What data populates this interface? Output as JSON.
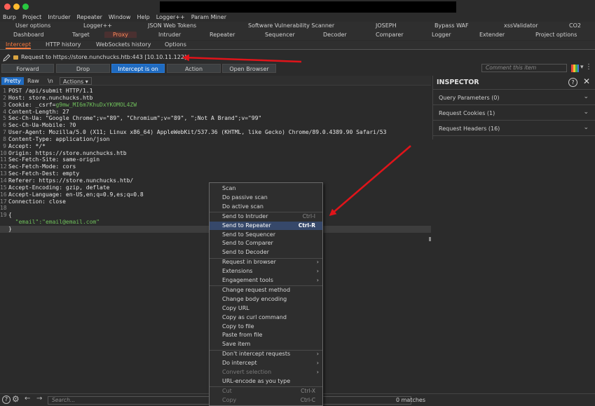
{
  "menubar": [
    "Burp",
    "Project",
    "Intruder",
    "Repeater",
    "Window",
    "Help",
    "Logger++",
    "Param Miner"
  ],
  "extension_tabs": [
    "User options",
    "Logger++",
    "JSON Web Tokens",
    "Software Vulnerability Scanner",
    "JOSEPH",
    "Bypass WAF",
    "xssValidator",
    "CO2"
  ],
  "main_tabs": [
    "Dashboard",
    "Target",
    "Proxy",
    "Intruder",
    "Repeater",
    "Sequencer",
    "Decoder",
    "Comparer",
    "Logger",
    "Extender",
    "Project options"
  ],
  "proxy_tabs": [
    "Intercept",
    "HTTP history",
    "WebSockets history",
    "Options"
  ],
  "request_info": "Request to https://store.nunchucks.htb:443  [10.10.11.122]",
  "buttons": {
    "forward": "Forward",
    "drop": "Drop",
    "intercept": "Intercept is on",
    "action": "Action",
    "open_browser": "Open Browser"
  },
  "comment_placeholder": "Comment this item",
  "editor_tabs": [
    "Pretty",
    "Raw",
    "\\n",
    "Actions ▾"
  ],
  "request_lines": [
    {
      "n": "1",
      "text": "POST /api/submit HTTP/1.1",
      "cls": ""
    },
    {
      "n": "2",
      "text": "Host: store.nunchucks.htb",
      "cls": ""
    },
    {
      "n": "3",
      "text": "Cookie: _csrf=g9mw_MI6m7KhuDxYKOMOL4ZW",
      "cls": "cookie"
    },
    {
      "n": "4",
      "text": "Content-Length: 27",
      "cls": ""
    },
    {
      "n": "5",
      "text": "Sec-Ch-Ua: \"Google Chrome\";v=\"89\", \"Chromium\";v=\"89\", \";Not A Brand\";v=\"99\"",
      "cls": ""
    },
    {
      "n": "6",
      "text": "Sec-Ch-Ua-Mobile: ?0",
      "cls": ""
    },
    {
      "n": "7",
      "text": "User-Agent: Mozilla/5.0 (X11; Linux x86_64) AppleWebKit/537.36 (KHTML, like Gecko) Chrome/89.0.4389.90 Safari/53",
      "cls": ""
    },
    {
      "n": "8",
      "text": "Content-Type: application/json",
      "cls": ""
    },
    {
      "n": "9",
      "text": "Accept: */*",
      "cls": ""
    },
    {
      "n": "10",
      "text": "Origin: https://store.nunchucks.htb",
      "cls": ""
    },
    {
      "n": "11",
      "text": "Sec-Fetch-Site: same-origin",
      "cls": ""
    },
    {
      "n": "12",
      "text": "Sec-Fetch-Mode: cors",
      "cls": ""
    },
    {
      "n": "13",
      "text": "Sec-Fetch-Dest: empty",
      "cls": ""
    },
    {
      "n": "14",
      "text": "Referer: https://store.nunchucks.htb/",
      "cls": ""
    },
    {
      "n": "15",
      "text": "Accept-Encoding: gzip, deflate",
      "cls": ""
    },
    {
      "n": "16",
      "text": "Accept-Language: en-US,en;q=0.9,es;q=0.8",
      "cls": ""
    },
    {
      "n": "17",
      "text": "Connection: close",
      "cls": ""
    },
    {
      "n": "18",
      "text": "",
      "cls": ""
    },
    {
      "n": "19",
      "text": "{",
      "cls": ""
    },
    {
      "n": "",
      "text": "  \"email\":\"email@email.com\"",
      "cls": "json"
    },
    {
      "n": "",
      "text": "}",
      "cls": "hl"
    }
  ],
  "inspector": {
    "title": "INSPECTOR",
    "rows": [
      "Query Parameters (0)",
      "Request Cookies (1)",
      "Request Headers (16)"
    ]
  },
  "search_placeholder": "Search...",
  "matches": "0 matches",
  "context_menu": [
    {
      "label": "Scan",
      "shortcut": "",
      "sub": false,
      "disabled": false,
      "sel": false
    },
    {
      "label": "Do passive scan",
      "shortcut": "",
      "sub": false,
      "disabled": false,
      "sel": false
    },
    {
      "label": "Do active scan",
      "shortcut": "",
      "sub": false,
      "disabled": false,
      "sel": false
    },
    {
      "label": "Send to Intruder",
      "shortcut": "Ctrl-I",
      "sub": false,
      "disabled": false,
      "sel": false
    },
    {
      "label": "Send to Repeater",
      "shortcut": "Ctrl-R",
      "sub": false,
      "disabled": false,
      "sel": true
    },
    {
      "label": "Send to Sequencer",
      "shortcut": "",
      "sub": false,
      "disabled": false,
      "sel": false
    },
    {
      "label": "Send to Comparer",
      "shortcut": "",
      "sub": false,
      "disabled": false,
      "sel": false
    },
    {
      "label": "Send to Decoder",
      "shortcut": "",
      "sub": false,
      "disabled": false,
      "sel": false
    },
    {
      "label": "Request in browser",
      "shortcut": "",
      "sub": true,
      "disabled": false,
      "sel": false
    },
    {
      "label": "Extensions",
      "shortcut": "",
      "sub": true,
      "disabled": false,
      "sel": false
    },
    {
      "label": "Engagement tools",
      "shortcut": "",
      "sub": true,
      "disabled": false,
      "sel": false
    },
    {
      "label": "Change request method",
      "shortcut": "",
      "sub": false,
      "disabled": false,
      "sel": false
    },
    {
      "label": "Change body encoding",
      "shortcut": "",
      "sub": false,
      "disabled": false,
      "sel": false
    },
    {
      "label": "Copy URL",
      "shortcut": "",
      "sub": false,
      "disabled": false,
      "sel": false
    },
    {
      "label": "Copy as curl command",
      "shortcut": "",
      "sub": false,
      "disabled": false,
      "sel": false
    },
    {
      "label": "Copy to file",
      "shortcut": "",
      "sub": false,
      "disabled": false,
      "sel": false
    },
    {
      "label": "Paste from file",
      "shortcut": "",
      "sub": false,
      "disabled": false,
      "sel": false
    },
    {
      "label": "Save item",
      "shortcut": "",
      "sub": false,
      "disabled": false,
      "sel": false
    },
    {
      "label": "Don't intercept requests",
      "shortcut": "",
      "sub": true,
      "disabled": false,
      "sel": false
    },
    {
      "label": "Do intercept",
      "shortcut": "",
      "sub": true,
      "disabled": false,
      "sel": false
    },
    {
      "label": "Convert selection",
      "shortcut": "",
      "sub": true,
      "disabled": true,
      "sel": false
    },
    {
      "label": "URL-encode as you type",
      "shortcut": "",
      "sub": false,
      "disabled": false,
      "sel": false
    },
    {
      "label": "Cut",
      "shortcut": "Ctrl-X",
      "sub": false,
      "disabled": true,
      "sel": false
    },
    {
      "label": "Copy",
      "shortcut": "Ctrl-C",
      "sub": false,
      "disabled": true,
      "sel": false
    },
    {
      "label": "Paste",
      "shortcut": "Ctrl-V",
      "sub": false,
      "disabled": false,
      "sel": false
    }
  ],
  "colors": {
    "accent": "#ff7a3c",
    "primary_button": "#1f6bc1",
    "annotation_arrow": "#e0141a",
    "menu_selection": "#36486a"
  }
}
